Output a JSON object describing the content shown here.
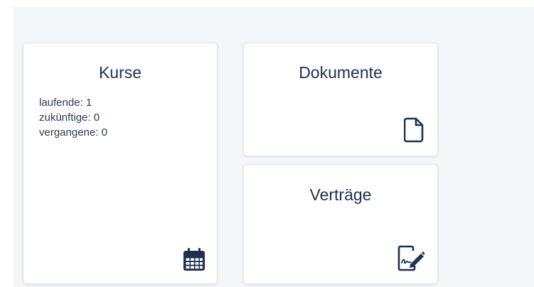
{
  "colors": {
    "page_background": "#ffffff",
    "panel_background": "#f3f7fa",
    "card_background": "#ffffff",
    "card_border": "#dde3e8",
    "title_text": "#1e3151",
    "body_text": "#2a3a52",
    "icon": "#1e3151"
  },
  "cards": {
    "kurse": {
      "title": "Kurse",
      "icon": "calendar-icon",
      "stats": [
        {
          "label": "laufende",
          "value": "1"
        },
        {
          "label": "zukünftige",
          "value": "0"
        },
        {
          "label": "vergangene",
          "value": "0"
        }
      ]
    },
    "dokumente": {
      "title": "Dokumente",
      "icon": "document-icon"
    },
    "vertraege": {
      "title": "Verträge",
      "icon": "contract-icon"
    }
  }
}
